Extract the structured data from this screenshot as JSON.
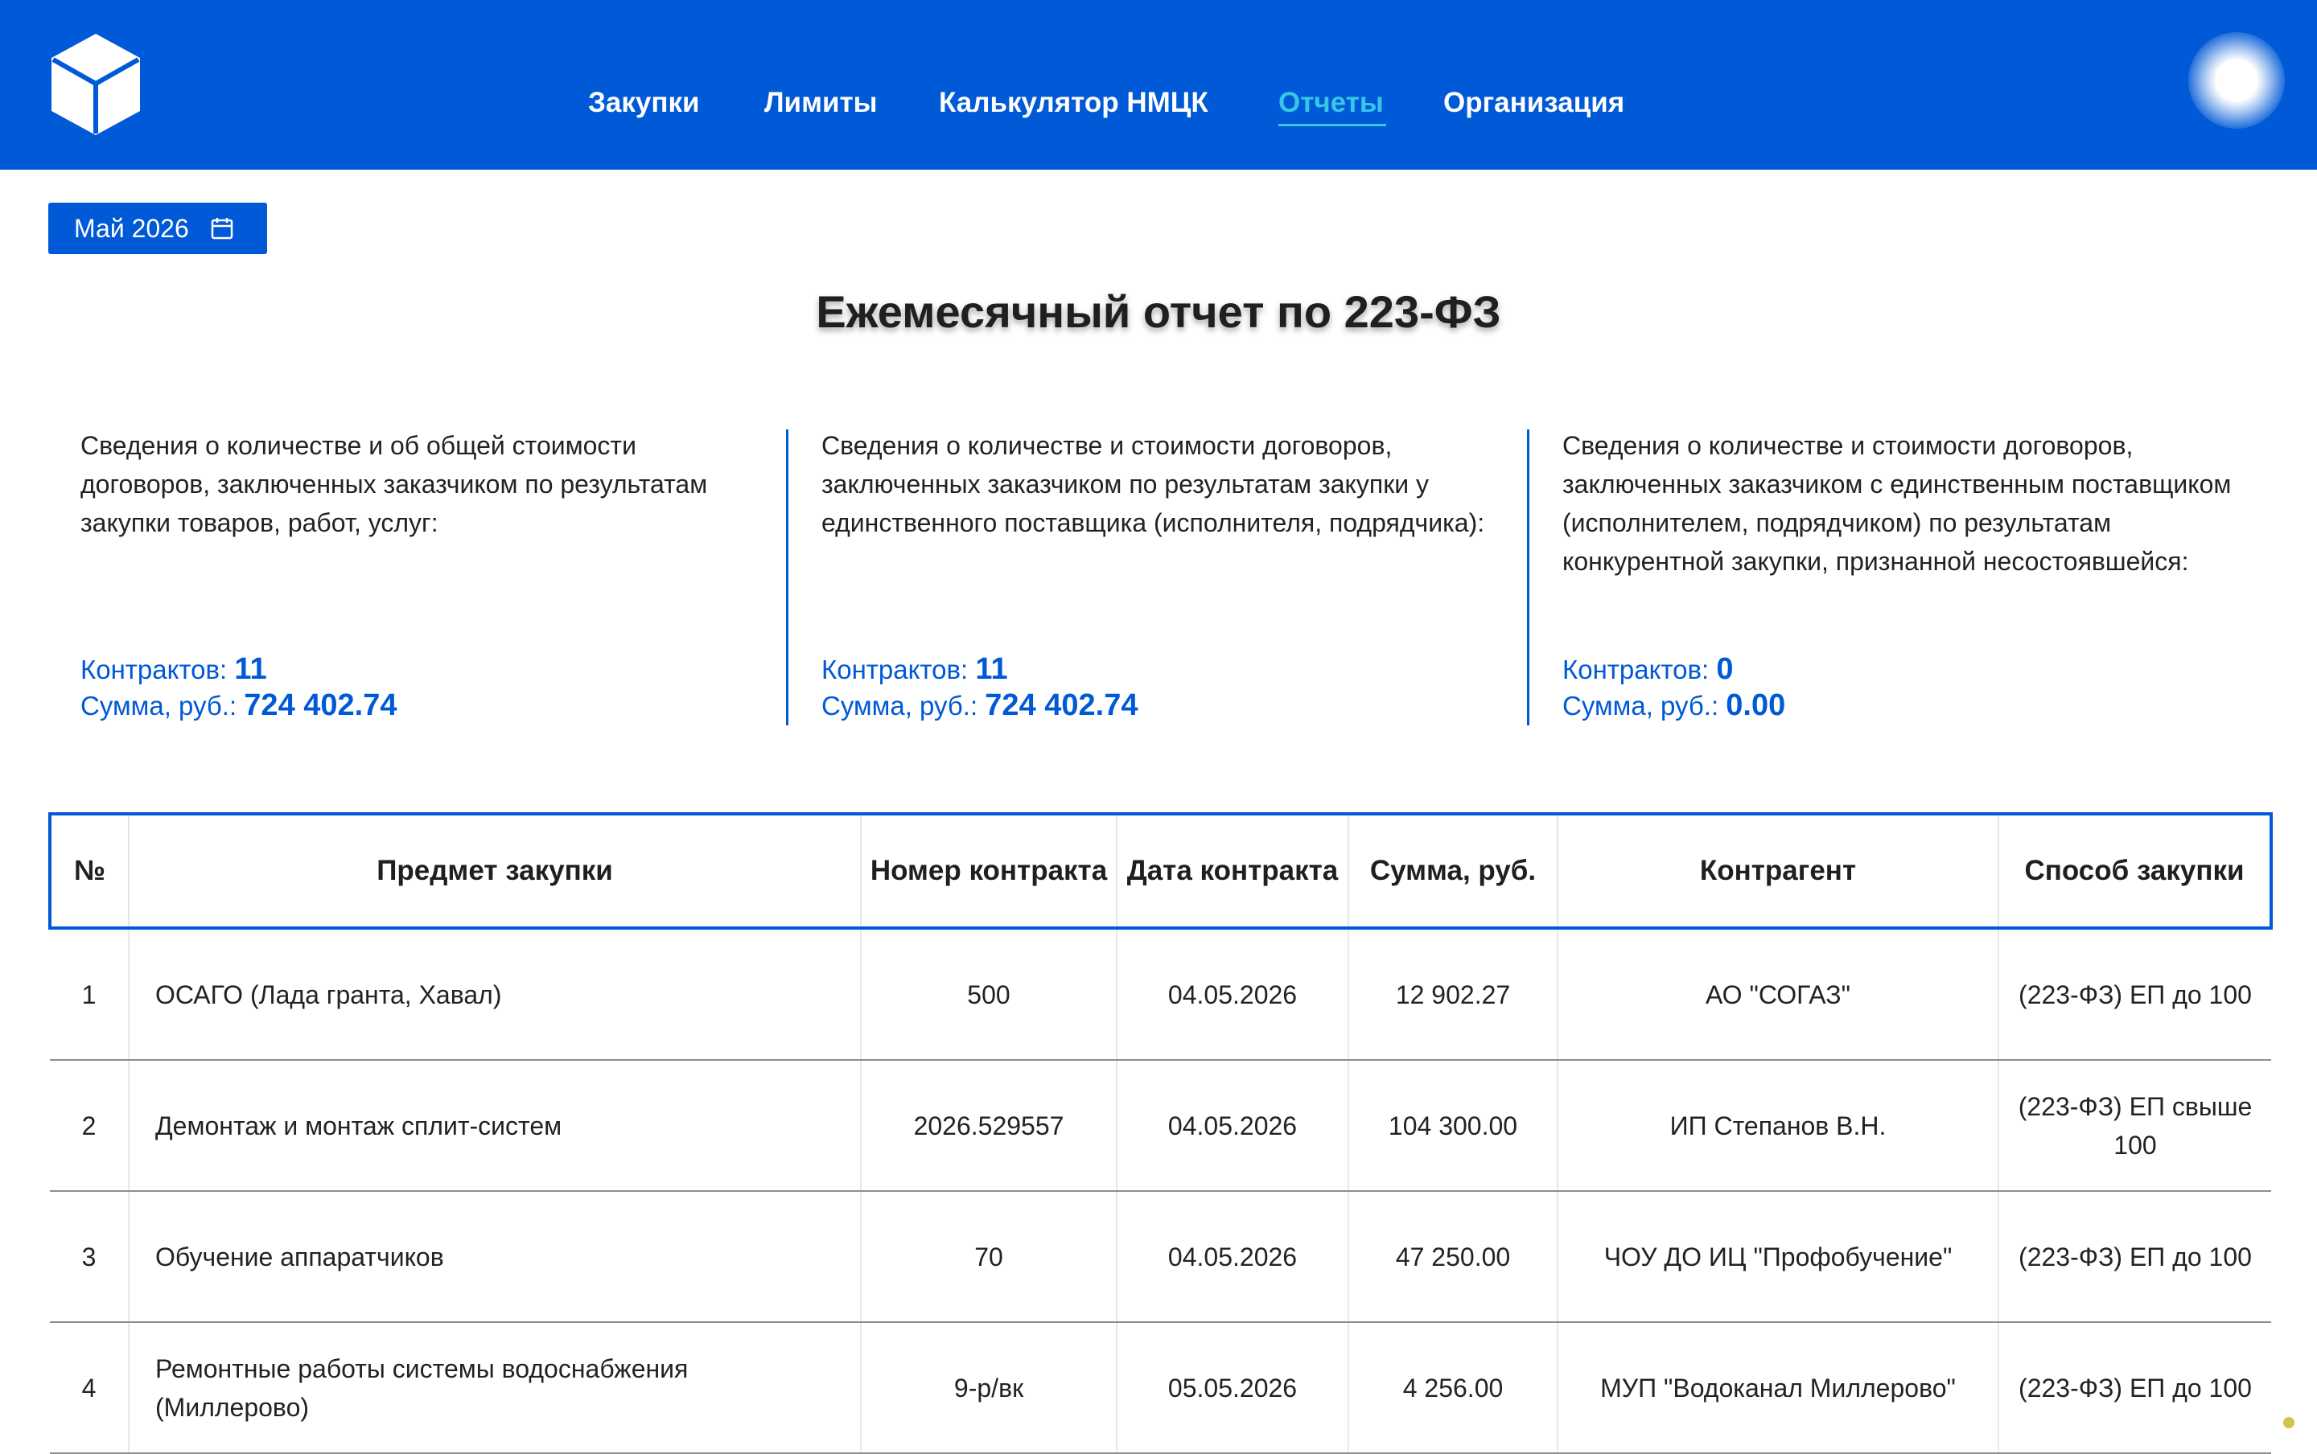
{
  "nav": {
    "items": [
      {
        "label": "Закупки"
      },
      {
        "label": "Лимиты"
      },
      {
        "label": "Калькулятор НМЦК"
      },
      {
        "label": "Отчеты"
      },
      {
        "label": "Организация"
      }
    ],
    "active": "Отчеты",
    "logo_icon": "cube-logo-icon",
    "avatar_icon": "avatar-glow-icon"
  },
  "month_picker": {
    "label": "Май 2026",
    "icon": "calendar-icon"
  },
  "page_title": "Ежемесячный отчет по 223-ФЗ",
  "summary": [
    {
      "description": "Сведения о количестве и об общей стоимости договоров, заключенных заказчиком по результатам закупки товаров, работ, услуг:",
      "contracts_label": "Контрактов:",
      "contracts_value": "11",
      "sum_label": "Сумма, руб.:",
      "sum_value": "724 402.74"
    },
    {
      "description": "Сведения о количестве и стоимости договоров, заключенных заказчиком по результатам закупки у единственного поставщика (исполнителя, подрядчика):",
      "contracts_label": "Контрактов:",
      "contracts_value": "11",
      "sum_label": "Сумма, руб.:",
      "sum_value": "724 402.74"
    },
    {
      "description": "Сведения о количестве и стоимости договоров, заключенных заказчиком с единственным поставщиком (исполнителем, подрядчиком) по результатам конкурентной закупки, признанной несостоявшейся:",
      "contracts_label": "Контрактов:",
      "contracts_value": "0",
      "sum_label": "Сумма, руб.:",
      "sum_value": "0.00"
    }
  ],
  "table": {
    "headers": {
      "num": "№",
      "subject": "Предмет закупки",
      "contract_no": "Номер контракта",
      "contract_date": "Дата контракта",
      "sum": "Сумма, руб.",
      "counterparty": "Контрагент",
      "method": "Способ закупки"
    },
    "rows": [
      {
        "num": "1",
        "subject": "ОСАГО (Лада гранта, Хавал)",
        "contract_no": "500",
        "contract_date": "04.05.2026",
        "sum": "12 902.27",
        "counterparty": "АО \"СОГАЗ\"",
        "method": "(223-ФЗ) ЕП до 100"
      },
      {
        "num": "2",
        "subject": "Демонтаж и монтаж сплит-систем",
        "contract_no": "2026.529557",
        "contract_date": "04.05.2026",
        "sum": "104 300.00",
        "counterparty": "ИП Степанов В.Н.",
        "method": "(223-ФЗ) ЕП свыше 100"
      },
      {
        "num": "3",
        "subject": "Обучение аппаратчиков",
        "contract_no": "70",
        "contract_date": "04.05.2026",
        "sum": "47 250.00",
        "counterparty": "ЧОУ ДО ИЦ \"Профобучение\"",
        "method": "(223-ФЗ) ЕП до 100"
      },
      {
        "num": "4",
        "subject": "Ремонтные работы системы водоснабжения (Миллерово)",
        "contract_no": "9-р/вк",
        "contract_date": "05.05.2026",
        "sum": "4 256.00",
        "counterparty": "МУП \"Водоканал Миллерово\"",
        "method": "(223-ФЗ) ЕП до 100"
      }
    ]
  },
  "colors": {
    "brand": "#0059d6",
    "active_nav": "#37c6ea"
  }
}
